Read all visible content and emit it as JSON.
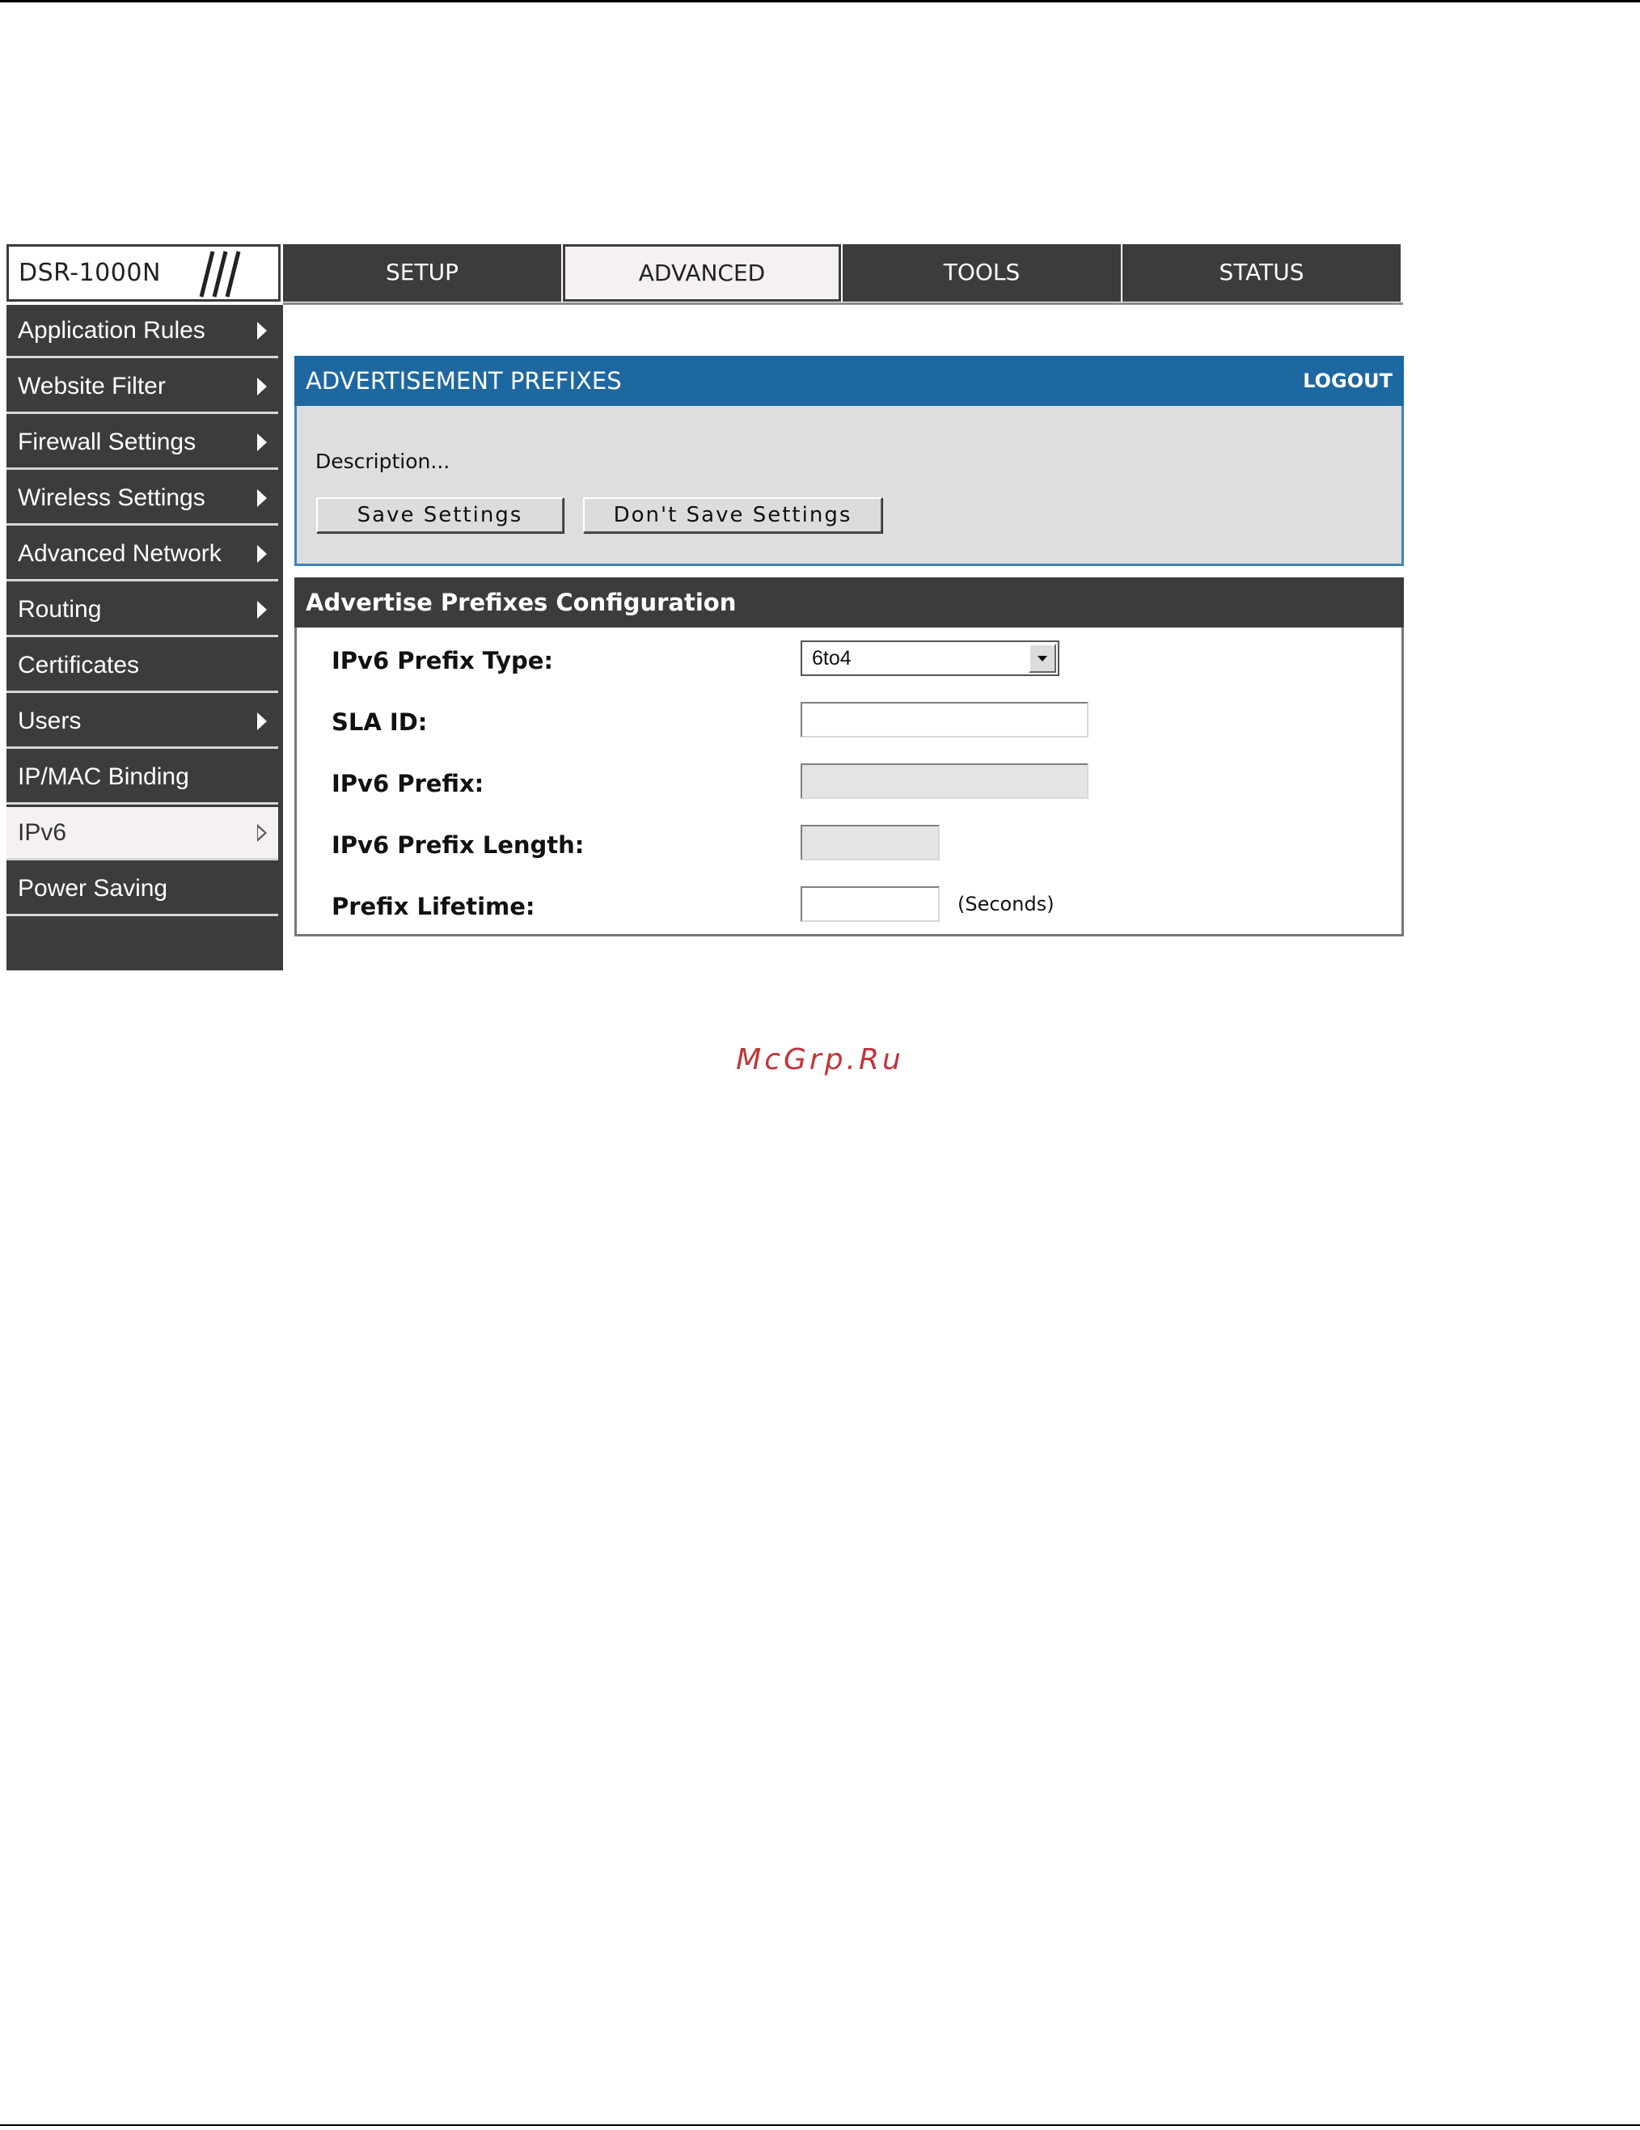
{
  "brand": {
    "name": "DSR-1000N",
    "logo_icon": "triple-slash-icon"
  },
  "topnav": {
    "tabs": [
      {
        "label": "SETUP",
        "active": false
      },
      {
        "label": "ADVANCED",
        "active": true
      },
      {
        "label": "TOOLS",
        "active": false
      },
      {
        "label": "STATUS",
        "active": false
      }
    ]
  },
  "sidebar": {
    "items": [
      {
        "label": "Application Rules",
        "arrow": "solid"
      },
      {
        "label": "Website Filter",
        "arrow": "solid"
      },
      {
        "label": "Firewall Settings",
        "arrow": "solid"
      },
      {
        "label": "Wireless Settings",
        "arrow": "solid"
      },
      {
        "label": "Advanced Network",
        "arrow": "solid"
      },
      {
        "label": "Routing",
        "arrow": "solid"
      },
      {
        "label": "Certificates",
        "arrow": "none"
      },
      {
        "label": "Users",
        "arrow": "solid"
      },
      {
        "label": "IP/MAC Binding",
        "arrow": "none"
      },
      {
        "label": "IPv6",
        "arrow": "hollow",
        "active": true
      },
      {
        "label": "Power Saving",
        "arrow": "none"
      }
    ]
  },
  "panel": {
    "title": "ADVERTISEMENT PREFIXES",
    "logout": "LOGOUT",
    "description": "Description...",
    "save_label": "Save Settings",
    "dont_save_label": "Don't Save Settings"
  },
  "config": {
    "title": "Advertise Prefixes Configuration",
    "prefix_type_label": "IPv6 Prefix Type:",
    "prefix_type_value": "6to4",
    "sla_id_label": "SLA ID:",
    "sla_id_value": "",
    "prefix_label": "IPv6 Prefix:",
    "prefix_value": "",
    "prefix_length_label": "IPv6 Prefix Length:",
    "prefix_length_value": "",
    "lifetime_label": "Prefix Lifetime:",
    "lifetime_value": "",
    "lifetime_unit": "(Seconds)"
  },
  "colors": {
    "header_blue": "#1e68a2",
    "nav_dark": "#3c3c3c",
    "panel_gray": "#dedede",
    "watermark_red": "#c0353a"
  },
  "watermark": "McGrp.Ru"
}
